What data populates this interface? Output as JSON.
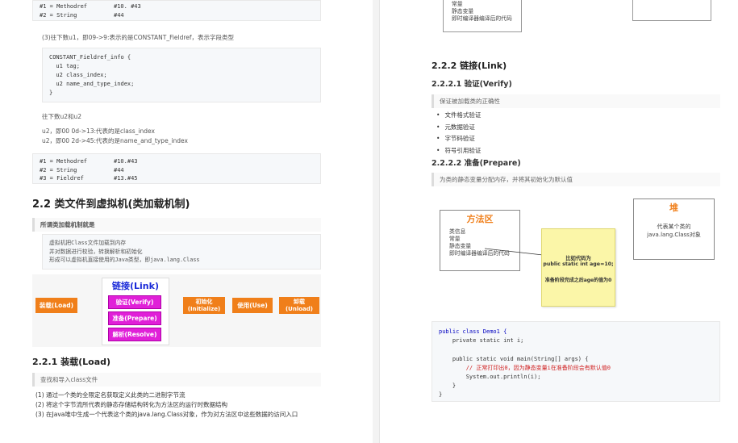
{
  "left": {
    "top_code": [
      [
        "#1 = Methodref",
        "#10. #43"
      ],
      [
        "#2 = String",
        "#44"
      ]
    ],
    "para_constant": "(3)往下数u1，即09->9:表示的是CONSTANT_Fieldref，表示字段类型",
    "struct_code": [
      "CONSTANT_Fieldref_info {",
      "  u1 tag;",
      "  u2 class_index;",
      "  u2 name_and_type_index;",
      "}"
    ],
    "para_u2": "往下数u2和u2",
    "para_class_index": "u2，即00 0d->13:代表的是class_index",
    "para_name_type": "u2，即00 2d->45:代表的是name_and_type_index",
    "mid_code": [
      [
        "#1 = Methodref",
        "#10.#43"
      ],
      [
        "#2 = String",
        "#44"
      ],
      [
        "#3 = Fieldref",
        "#13.#45"
      ]
    ],
    "h2_title": "2.2 类文件到虚拟机(类加载机制)",
    "quote_title": "所谓类加载机制就是",
    "quote_lines": [
      "虚拟机把Class文件加载到内存",
      "并对数据进行校验，转换解析和初始化",
      "形成可以虚拟机直接使用的Java类型，即java.lang.Class"
    ],
    "diagram": {
      "link_title": "链接(Link)",
      "load": "装载(Load)",
      "verify": "验证(Verify)",
      "prepare": "准备(Prepare)",
      "resolve": "解析(Resolve)",
      "init": "初始化\n(Initialize)",
      "use": "使用(Use)",
      "unload": "卸载\n(Unload)"
    },
    "h3_load": "2.2.1 装载(Load)",
    "quote_load": "查找和导入class文件",
    "steps": [
      "(1) 通过一个类的全限定名获取定义此类的二进制字节流",
      "(2) 将这个字节流所代表的静态存储结构转化为方法区的运行时数据结构",
      "(3) 在Java堆中生成一个代表这个类的java.lang.Class对象，作为对方法区中这些数据的访问入口"
    ]
  },
  "right": {
    "top_box_lines": [
      "常量",
      "静态变量",
      "即时编译器编译后的代码"
    ],
    "h3_link": "2.2.2 链接(Link)",
    "h4_verify": "2.2.2.1 验证(Verify)",
    "quote_verify": "保证被加载类的正确性",
    "verify_list": [
      "文件格式验证",
      "元数据验证",
      "字节码验证",
      "符号引用验证"
    ],
    "h4_prepare": "2.2.2.2 准备(Prepare)",
    "quote_prepare": "为类的静态变量分配内存，并将其初始化为默认值",
    "method_area": {
      "title": "方法区",
      "lines": [
        "类信息",
        "常量",
        "静态变量",
        "即时编译器编译后的代码"
      ]
    },
    "heap": {
      "title": "堆",
      "lines": [
        "代表某个类的",
        "java.lang.Class对象"
      ]
    },
    "note": {
      "line1": "比如代码为",
      "line2": "public static int age=10;",
      "line3": "准备阶段完成之后age的值为0"
    },
    "code": {
      "l1": "public class Demo1 {",
      "l2": "    private static int i;",
      "l3": "    public static void main(String[] args) {",
      "l4": "        // 正常打印出0，因为静态变量i在准备阶段会有默认值0",
      "l5": "        System.out.println(i);",
      "l6": "    }",
      "l7": "}"
    }
  }
}
